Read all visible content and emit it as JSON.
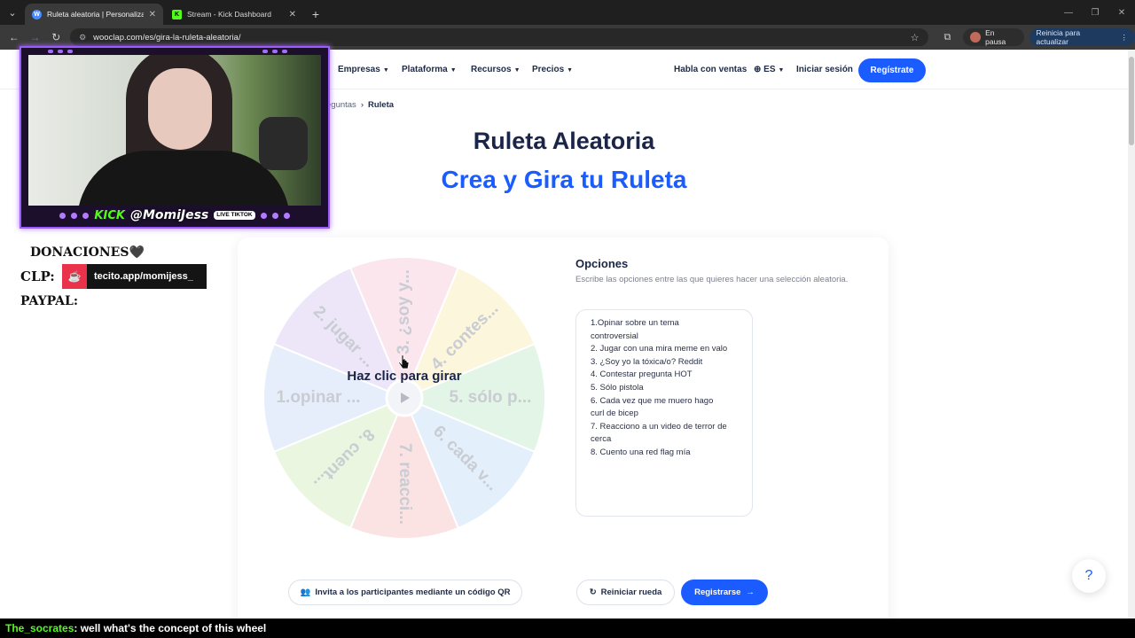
{
  "browser": {
    "tabs": [
      {
        "title": "Ruleta aleatoria | Personaliza y",
        "favicon": "W",
        "active": true
      },
      {
        "title": "Stream - Kick Dashboard",
        "favicon": "K",
        "active": false
      }
    ],
    "url": "wooclap.com/es/gira-la-ruleta-aleatoria/",
    "pause_label": "En pausa",
    "update_label": "Reinicia para actualizar"
  },
  "nav": {
    "items": [
      "Empresas",
      "Plataforma",
      "Recursos",
      "Precios"
    ],
    "sales": "Habla con ventas",
    "lang": "ES",
    "login": "Iniciar sesión",
    "register": "Regístrate"
  },
  "breadcrumb": {
    "prev": "eguntas",
    "current": "Ruleta"
  },
  "hero": {
    "title": "Ruleta Aleatoria",
    "subtitle": "Crea y Gira tu Ruleta"
  },
  "wheel": {
    "cta": "Haz clic para girar",
    "segments": [
      {
        "label": "1.opinar ...",
        "color": "#e6eefc"
      },
      {
        "label": "2. jugar ...",
        "color": "#ece6f8"
      },
      {
        "label": "3. ¿soy y...",
        "color": "#fbe6ee"
      },
      {
        "label": "4. contes...",
        "color": "#fcf6dc"
      },
      {
        "label": "5. sólo p...",
        "color": "#e3f5e6"
      },
      {
        "label": "6. cada v...",
        "color": "#e3effb"
      },
      {
        "label": "7. reacci...",
        "color": "#fbe3e3"
      },
      {
        "label": "8. cuent...",
        "color": "#eaf6df"
      }
    ]
  },
  "options": {
    "title": "Opciones",
    "description": "Escribe las opciones entre las que quieres hacer una selección aleatoria.",
    "lines": [
      "1.Opinar sobre un tema",
      "controversial",
      "2. Jugar con una mira meme en valo",
      "3. ¿Soy yo la tóxica/o? Reddit",
      "4. Contestar pregunta HOT",
      "5. Sólo pistola",
      "6. Cada vez que me muero hago",
      "curl de bicep",
      "7. Reacciono a un video de terror de",
      "cerca",
      "8. Cuento una red flag mía"
    ]
  },
  "buttons": {
    "qr": "Invita a los participantes mediante un código QR",
    "reset": "Reiniciar rueda",
    "register": "Registrarse",
    "help": "?"
  },
  "overlay": {
    "kick": "KICK",
    "handle": "@MomiJess",
    "tiktok_badge": "LIVE TIKTOK",
    "donations": "DONACIONES🖤",
    "clp": "CLP:",
    "tecito": "tecito.app/momijess_",
    "paypal": "PAYPAL:"
  },
  "chat": {
    "user": "The_socrates",
    "message": " : well what's the concept of this wheel"
  },
  "colors": {
    "accent": "#1a5cff",
    "navy": "#1b2547",
    "kick_green": "#53fc18",
    "overlay_purple": "#9a5cff"
  }
}
